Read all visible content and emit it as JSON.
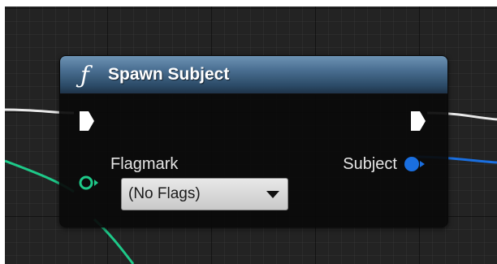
{
  "node": {
    "title": "Spawn Subject",
    "icon": "function-icon",
    "header_color": "#4c7194"
  },
  "pins": {
    "input_label": "Flagmark",
    "output_label": "Subject",
    "input_color": "#1ec989",
    "output_color": "#1a6fe0",
    "exec_color": "#ffffff"
  },
  "dropdown": {
    "selected": "(No Flags)"
  }
}
